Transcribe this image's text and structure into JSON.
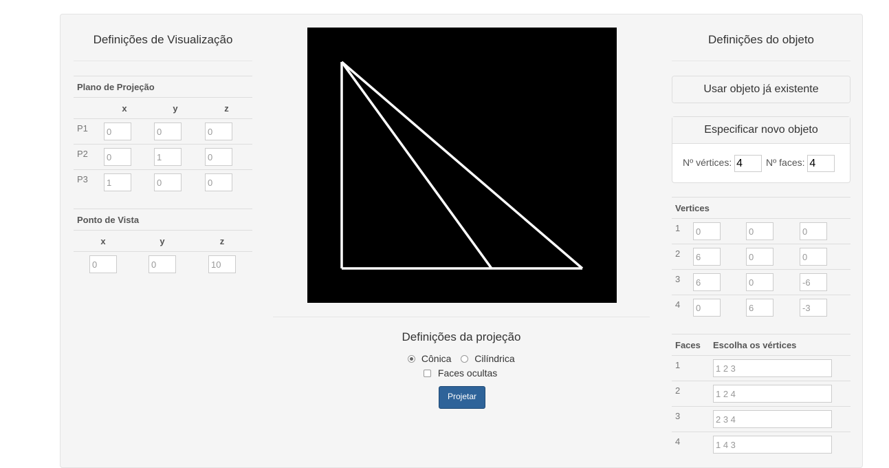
{
  "left": {
    "title": "Definições de Visualização",
    "plane": {
      "caption": "Plano de Projeção",
      "headers": [
        "x",
        "y",
        "z"
      ],
      "rows": [
        {
          "label": "P1",
          "values": [
            "0",
            "0",
            "0"
          ]
        },
        {
          "label": "P2",
          "values": [
            "0",
            "1",
            "0"
          ]
        },
        {
          "label": "P3",
          "values": [
            "1",
            "0",
            "0"
          ]
        }
      ]
    },
    "viewpoint": {
      "caption": "Ponto de Vista",
      "headers": [
        "x",
        "y",
        "z"
      ],
      "values": [
        "0",
        "0",
        "10"
      ]
    }
  },
  "center": {
    "canvas_bg": "#000000",
    "line_color": "#ffffff",
    "projection": {
      "title": "Definições da projeção",
      "conic_label": "Cônica",
      "cylindrical_label": "Cilíndrica",
      "conic_selected": true,
      "hidden_faces_label": "Faces ocultas",
      "hidden_faces_checked": false,
      "button_label": "Projetar"
    }
  },
  "right": {
    "title": "Definições do objeto",
    "use_existing_label": "Usar objeto já existente",
    "new_object": {
      "header": "Especificar novo objeto",
      "vertices_label": "Nº vértices:",
      "vertices_value": "4",
      "faces_label": "Nº faces:",
      "faces_value": "4"
    },
    "vertices": {
      "caption": "Vertices",
      "rows": [
        {
          "label": "1",
          "values": [
            "0",
            "0",
            "0"
          ]
        },
        {
          "label": "2",
          "values": [
            "6",
            "0",
            "0"
          ]
        },
        {
          "label": "3",
          "values": [
            "6",
            "0",
            "-6"
          ]
        },
        {
          "label": "4",
          "values": [
            "0",
            "6",
            "-3"
          ]
        }
      ]
    },
    "faces": {
      "caption": "Faces",
      "caption2": "Escolha os vértices",
      "rows": [
        {
          "label": "1",
          "value": "1 2 3"
        },
        {
          "label": "2",
          "value": "1 2 4"
        },
        {
          "label": "3",
          "value": "2 3 4"
        },
        {
          "label": "4",
          "value": "1 4 3"
        }
      ]
    }
  },
  "accent": "#2e6399"
}
